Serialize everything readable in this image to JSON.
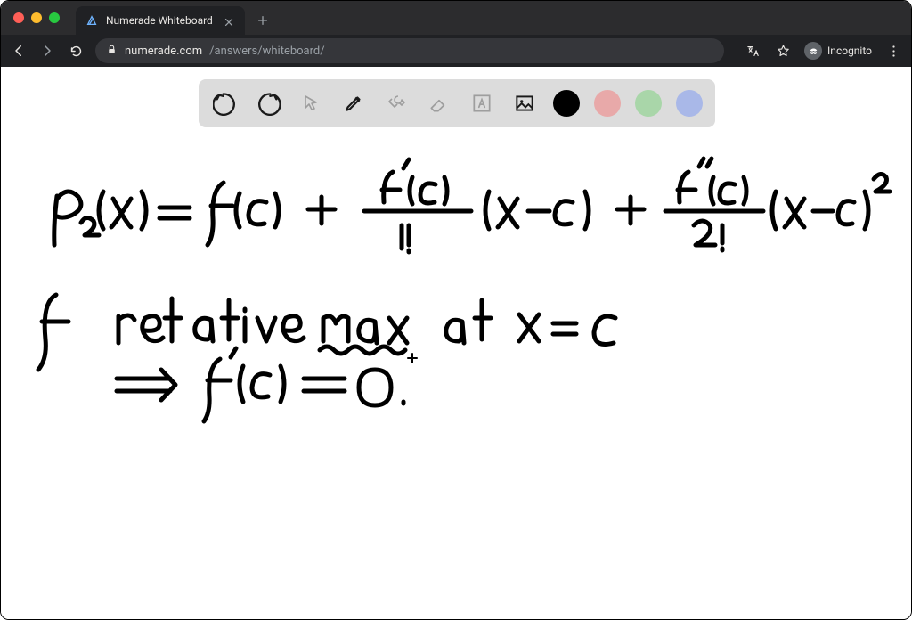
{
  "browser": {
    "tab_title": "Numerade Whiteboard",
    "url_host": "numerade.com",
    "url_path": "/answers/whiteboard/",
    "incognito_label": "Incognito"
  },
  "toolbar": {
    "colors": {
      "black": "#000000",
      "red": "#e8a9a9",
      "green": "#a9d6a9",
      "blue": "#a9b8e8"
    }
  },
  "handwriting": {
    "line1": "p₂(x) = f(c) + f'(c)/1! (x−c) + f''(c)/2! (x−c)²",
    "line2": "f  relative max  at  x = c",
    "line3": "⇒ f'(c) = 0."
  }
}
